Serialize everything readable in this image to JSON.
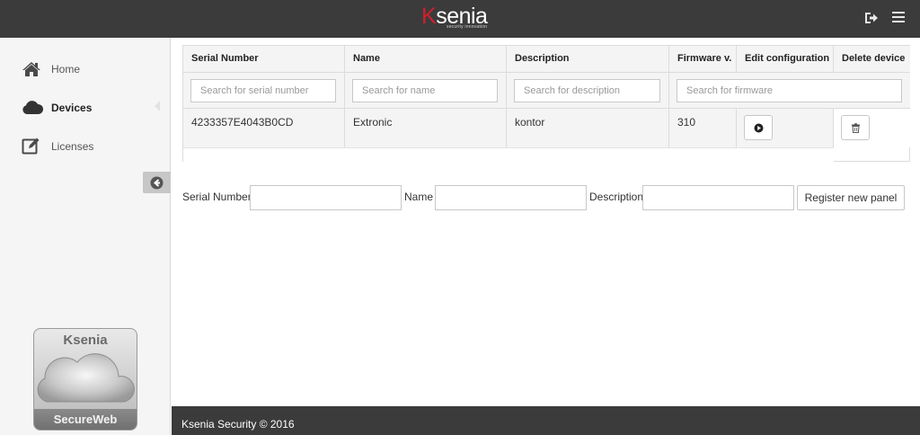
{
  "header": {
    "logo": {
      "text_main": "Ksenia",
      "tagline": "security innovation"
    },
    "logout_icon": "sign-out-icon",
    "menu_icon": "hamburger-menu-icon"
  },
  "sidebar": {
    "items": [
      {
        "label": "Home",
        "icon": "home-icon",
        "active": false
      },
      {
        "label": "Devices",
        "icon": "cloud-icon",
        "active": true
      },
      {
        "label": "Licenses",
        "icon": "edit-icon",
        "active": false
      }
    ],
    "collapse_icon": "arrow-circle-left-icon",
    "badge": {
      "top_text": "Ksenia",
      "bottom_text": "SecureWeb"
    }
  },
  "table": {
    "columns": [
      "Serial Number",
      "Name",
      "Description",
      "Firmware v.",
      "Edit configuration",
      "Delete device"
    ],
    "search_placeholders": {
      "serial": "Search for serial number",
      "name": "Search for name",
      "description": "Search for description",
      "firmware": "Search for firmware"
    },
    "rows": [
      {
        "serial": "4233357E4043B0CD",
        "name": "Extronic",
        "description": "kontor",
        "firmware": "310"
      }
    ]
  },
  "register": {
    "serial_label": "Serial Number",
    "name_label": "Name",
    "description_label": "Description",
    "button_label": "Register new panel"
  },
  "footer": {
    "text": "Ksenia Security © 2016"
  },
  "colors": {
    "bar": "#3b3b3b",
    "brand_red": "#d0202d",
    "sidebar_bg": "#f5f5f5"
  }
}
